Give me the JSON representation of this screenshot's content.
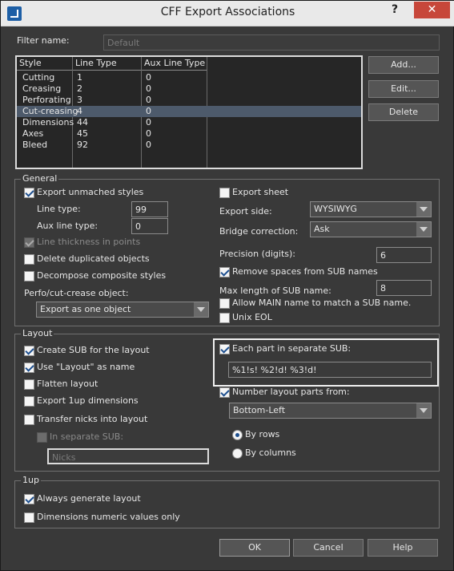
{
  "window": {
    "title": "CFF Export Associations",
    "help_glyph": "?",
    "close_glyph": "✕"
  },
  "filter": {
    "label": "Filter name:",
    "value": "Default"
  },
  "table": {
    "headers": [
      "Style",
      "Line Type",
      "Aux Line Type"
    ],
    "rows": [
      [
        "Cutting",
        "1",
        "0"
      ],
      [
        "Creasing",
        "2",
        "0"
      ],
      [
        "Perforating",
        "3",
        "0"
      ],
      [
        "Cut-creasing",
        "4",
        "0"
      ],
      [
        "Dimensions",
        "44",
        "0"
      ],
      [
        "Axes",
        "45",
        "0"
      ],
      [
        "Bleed",
        "92",
        "0"
      ]
    ],
    "selected_row": 3
  },
  "side_buttons": {
    "add": "Add...",
    "edit": "Edit...",
    "delete": "Delete"
  },
  "general": {
    "title": "General",
    "export_unmached": "Export unmached styles",
    "line_type_label": "Line type:",
    "line_type_value": "99",
    "aux_line_type_label": "Aux line type:",
    "aux_line_type_value": "0",
    "line_thickness": "Line thickness in points",
    "delete_duplicated": "Delete duplicated objects",
    "decompose_composite": "Decompose composite styles",
    "perfo_label": "Perfo/cut-crease object:",
    "perfo_value": "Export as one object",
    "export_sheet": "Export sheet",
    "export_side_label": "Export side:",
    "export_side_value": "WYSIWYG",
    "bridge_label": "Bridge correction:",
    "bridge_value": "Ask",
    "precision_label": "Precision (digits):",
    "precision_value": "6",
    "remove_spaces": "Remove spaces from SUB names",
    "max_length_label": "Max length of SUB name:",
    "max_length_value": "8",
    "allow_main": "Allow MAIN name to match a SUB name.",
    "unix_eol": "Unix EOL"
  },
  "layout": {
    "title": "Layout",
    "create_sub": "Create SUB for the layout",
    "use_layout_name": "Use \"Layout\" as name",
    "flatten": "Flatten layout",
    "export_1up": "Export 1up dimensions",
    "transfer_nicks": "Transfer nicks into layout",
    "in_separate_sub": "In separate SUB:",
    "nicks_value": "Nicks",
    "each_part": "Each part in separate SUB:",
    "each_part_value": "%1!s! %2!d! %3!d!",
    "number_parts": "Number layout parts from:",
    "number_parts_value": "Bottom-Left",
    "by_rows": "By rows",
    "by_columns": "By columns"
  },
  "oneup": {
    "title": "1up",
    "always_generate": "Always generate layout",
    "dimensions_numeric": "Dimensions numeric values only"
  },
  "footer": {
    "ok": "OK",
    "cancel": "Cancel",
    "help": "Help"
  }
}
